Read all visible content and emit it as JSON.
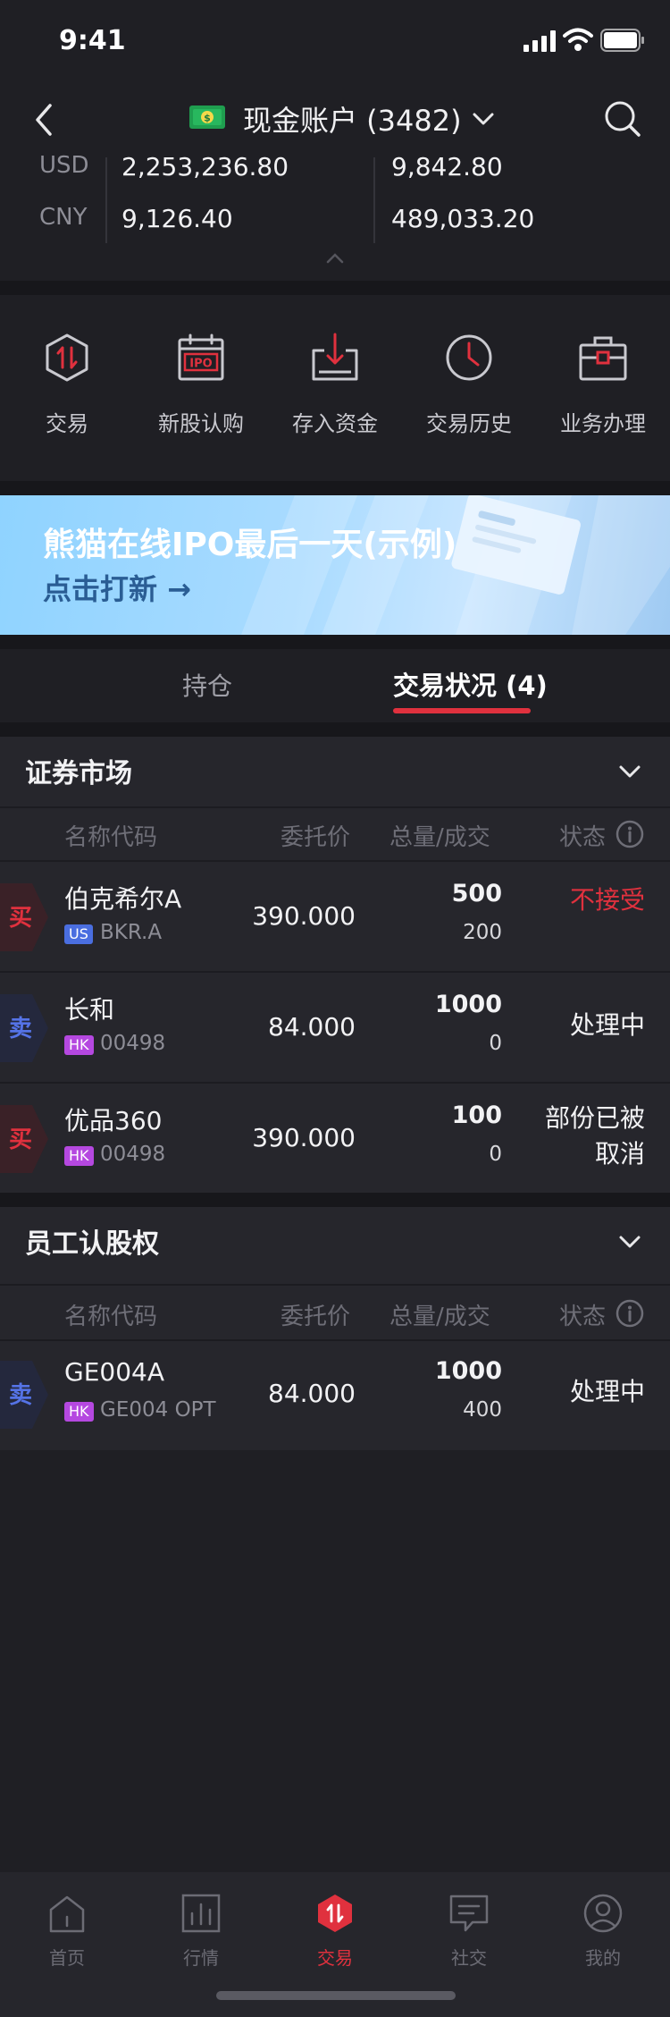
{
  "status_bar": {
    "time": "9:41"
  },
  "nav": {
    "title": "现金账户 (3482)"
  },
  "balances": [
    {
      "currency": "USD",
      "left": "2,253,236.80",
      "right": "9,842.80"
    },
    {
      "currency": "CNY",
      "left": "9,126.40",
      "right": "489,033.20"
    }
  ],
  "quick_actions": [
    {
      "label": "交易",
      "icon": "trade-hexagon-icon"
    },
    {
      "label": "新股认购",
      "icon": "ipo-calendar-icon"
    },
    {
      "label": "存入资金",
      "icon": "deposit-tray-icon"
    },
    {
      "label": "交易历史",
      "icon": "history-clock-icon"
    },
    {
      "label": "业务办理",
      "icon": "briefcase-icon"
    }
  ],
  "banner": {
    "title": "熊猫在线IPO最后一天(示例)",
    "subtitle": "点击打新 →"
  },
  "tabs": {
    "holdings": "持仓",
    "status": "交易状况 (4)"
  },
  "table_headers": {
    "name_code": "名称代码",
    "price": "委托价",
    "qty_filled": "总量/成交",
    "status": "状态"
  },
  "sections": [
    {
      "title": "证券市场",
      "orders": [
        {
          "side": "买",
          "side_type": "buy",
          "name": "伯克希尔A",
          "market": "US",
          "code": "BKR.A",
          "price": "390.000",
          "qty": "500",
          "filled": "200",
          "status": [
            "不接受"
          ],
          "status_color": "#e0313e"
        },
        {
          "side": "卖",
          "side_type": "sell",
          "name": "长和",
          "market": "HK",
          "code": "00498",
          "price": "84.000",
          "qty": "1000",
          "filled": "0",
          "status": [
            "处理中"
          ],
          "status_color": "#f2f2f4"
        },
        {
          "side": "买",
          "side_type": "buy",
          "name": "优品360",
          "market": "HK",
          "code": "00498",
          "price": "390.000",
          "qty": "100",
          "filled": "0",
          "status": [
            "部份已被",
            "取消"
          ],
          "status_color": "#f2f2f4"
        }
      ]
    },
    {
      "title": "员工认股权",
      "orders": [
        {
          "side": "卖",
          "side_type": "sell",
          "name": "GE004A",
          "market": "HK",
          "code": "GE004 OPT",
          "price": "84.000",
          "qty": "1000",
          "filled": "400",
          "status": [
            "处理中"
          ],
          "status_color": "#f2f2f4"
        }
      ]
    }
  ],
  "bottom_nav": [
    {
      "label": "首页",
      "icon": "home-icon",
      "active": false
    },
    {
      "label": "行情",
      "icon": "market-chart-icon",
      "active": false
    },
    {
      "label": "交易",
      "icon": "trade-hexagon-icon",
      "active": true
    },
    {
      "label": "社交",
      "icon": "chat-bubble-icon",
      "active": false
    },
    {
      "label": "我的",
      "icon": "profile-icon",
      "active": false
    }
  ],
  "colors": {
    "accent": "#e0313e",
    "buy": "#e0313e",
    "sell": "#5573e6",
    "background": "#1f1f24"
  }
}
